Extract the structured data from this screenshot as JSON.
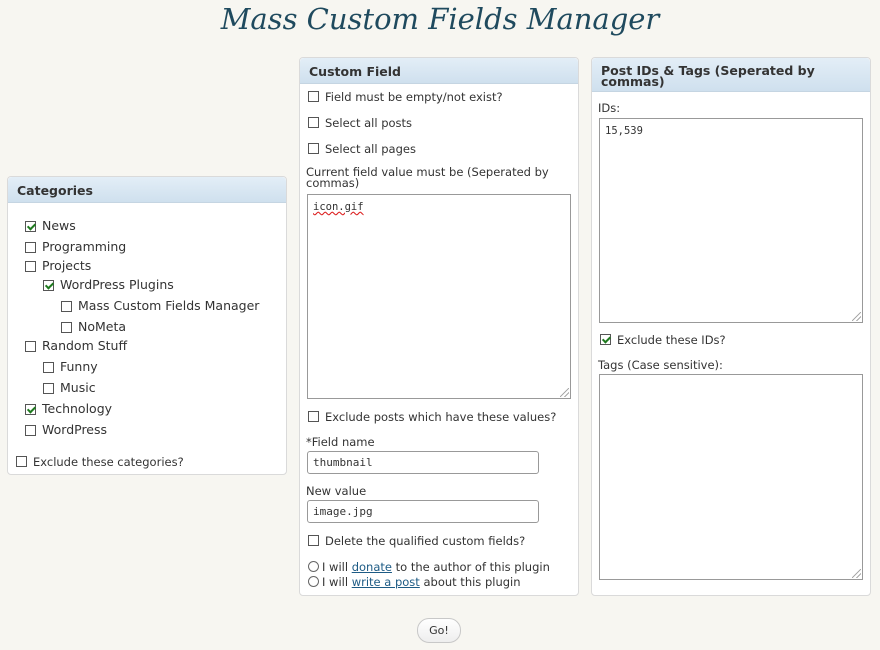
{
  "page": {
    "title": "Mass Custom Fields Manager"
  },
  "categories": {
    "heading": "Categories",
    "items": [
      {
        "label": "News",
        "checked": true
      },
      {
        "label": "Programming",
        "checked": false
      },
      {
        "label": "Projects",
        "checked": false
      },
      {
        "label": "WordPress Plugins",
        "checked": true
      },
      {
        "label": "Mass Custom Fields Manager",
        "checked": false
      },
      {
        "label": "NoMeta",
        "checked": false
      },
      {
        "label": "Random Stuff",
        "checked": false
      },
      {
        "label": "Funny",
        "checked": false
      },
      {
        "label": "Music",
        "checked": false
      },
      {
        "label": "Technology",
        "checked": true
      },
      {
        "label": "WordPress",
        "checked": false
      }
    ],
    "exclude_label": "Exclude these categories?",
    "exclude_checked": false
  },
  "custom_field": {
    "heading": "Custom Field",
    "opt_empty": "Field must be empty/not exist?",
    "opt_all_posts": "Select all posts",
    "opt_all_pages": "Select all pages",
    "value_label": "Current field value must be (Seperated by commas)",
    "value_text": "icon.gif",
    "exclude_values_label": "Exclude posts which have these values?",
    "field_name_label": "*Field name",
    "field_name_value": "thumbnail",
    "new_value_label": "New value",
    "new_value_value": "image.jpg",
    "delete_label": "Delete the qualified custom fields?",
    "donate_pre": "I will ",
    "donate_link": "donate",
    "donate_post": " to the author of this plugin",
    "write_pre": "I will ",
    "write_link": "write a post",
    "write_post": " about this plugin"
  },
  "post_ids": {
    "heading": "Post IDs & Tags (Seperated by commas)",
    "ids_label": "IDs:",
    "ids_value": "15,539",
    "exclude_ids_label": "Exclude these IDs?",
    "exclude_ids_checked": true,
    "tags_label": "Tags (Case sensitive):",
    "tags_value": ""
  },
  "actions": {
    "go_label": "Go!"
  },
  "colors": {
    "title": "#1f4a5e",
    "link": "#1d5b85",
    "check": "#1f7a1f"
  }
}
